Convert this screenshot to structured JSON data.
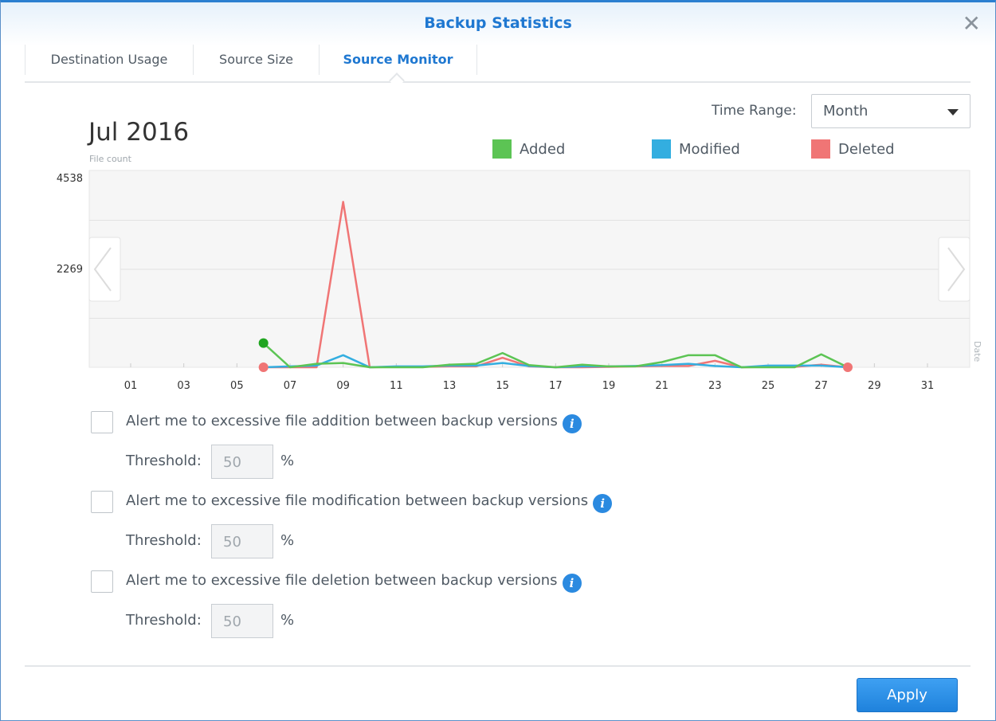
{
  "window": {
    "title": "Backup Statistics"
  },
  "tabs": [
    {
      "label": "Destination Usage"
    },
    {
      "label": "Source Size"
    },
    {
      "label": "Source Monitor",
      "active": true
    }
  ],
  "time_range": {
    "label": "Time Range:",
    "value": "Month"
  },
  "period": "Jul 2016",
  "chart_data": {
    "type": "line",
    "title": "Jul 2016",
    "ylabel": "File count",
    "xlabel": "Date",
    "ylim": [
      0,
      4538
    ],
    "yticks": [
      "4538",
      "2269"
    ],
    "xticks": [
      "01",
      "03",
      "05",
      "07",
      "09",
      "11",
      "13",
      "15",
      "17",
      "19",
      "21",
      "23",
      "25",
      "27",
      "29",
      "31"
    ],
    "x": [
      6,
      7,
      8,
      9,
      10,
      11,
      12,
      13,
      14,
      15,
      16,
      17,
      18,
      19,
      20,
      21,
      22,
      23,
      24,
      25,
      26,
      27,
      28
    ],
    "legend_position": "top-right",
    "series": [
      {
        "name": "Added",
        "color": "#5cc454",
        "values": [
          560,
          0,
          80,
          100,
          0,
          0,
          0,
          60,
          80,
          330,
          50,
          0,
          60,
          20,
          20,
          120,
          280,
          280,
          0,
          0,
          0,
          300,
          0
        ]
      },
      {
        "name": "Modified",
        "color": "#33aee0",
        "values": [
          0,
          20,
          40,
          280,
          0,
          20,
          20,
          40,
          40,
          100,
          30,
          0,
          20,
          20,
          30,
          50,
          80,
          30,
          0,
          40,
          40,
          40,
          0
        ]
      },
      {
        "name": "Deleted",
        "color": "#f07575",
        "values": [
          0,
          0,
          0,
          3830,
          0,
          10,
          10,
          20,
          20,
          220,
          20,
          0,
          0,
          10,
          20,
          30,
          30,
          150,
          0,
          10,
          10,
          60,
          0
        ]
      }
    ]
  },
  "alerts": [
    {
      "label": "Alert me to excessive file addition between backup versions",
      "threshold_label": "Threshold:",
      "threshold": "50",
      "unit": "%"
    },
    {
      "label": "Alert me to excessive file modification between backup versions",
      "threshold_label": "Threshold:",
      "threshold": "50",
      "unit": "%"
    },
    {
      "label": "Alert me to excessive file deletion between backup versions",
      "threshold_label": "Threshold:",
      "threshold": "50",
      "unit": "%"
    }
  ],
  "info_glyph": "i",
  "close_glyph": "✕",
  "footer": {
    "apply_label": "Apply"
  }
}
